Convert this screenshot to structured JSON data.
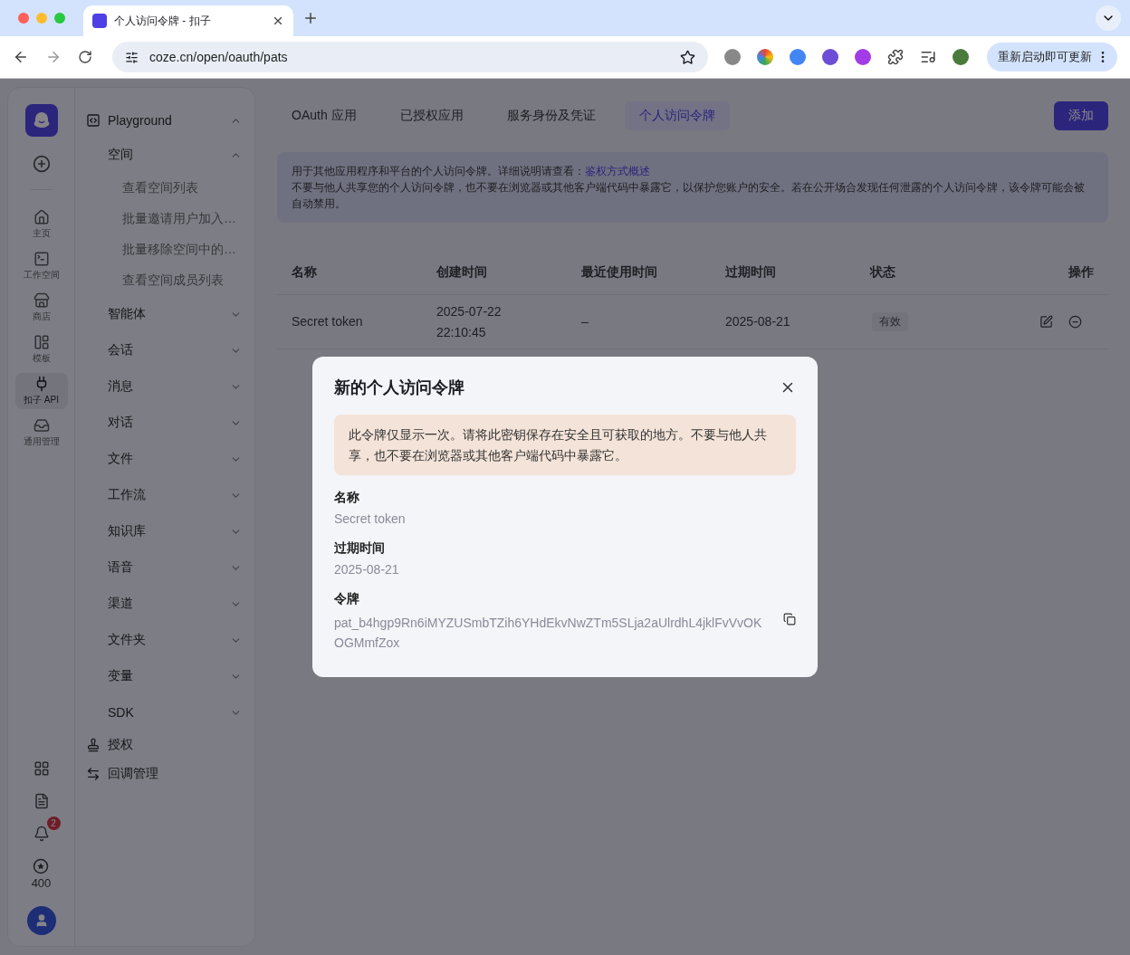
{
  "browser": {
    "tab_title": "个人访问令牌 - 扣子",
    "url": "coze.cn/open/oauth/pats",
    "update_button": "重新启动即可更新"
  },
  "rail": {
    "items": [
      {
        "label": "主页",
        "selected": false
      },
      {
        "label": "工作空间",
        "selected": false
      },
      {
        "label": "商店",
        "selected": false
      },
      {
        "label": "模板",
        "selected": false
      },
      {
        "label": "扣子 API",
        "selected": true
      },
      {
        "label": "通用管理",
        "selected": false
      }
    ],
    "notification_count": "2",
    "points": "400"
  },
  "nav": {
    "items": [
      {
        "label": "Playground",
        "expanded": true,
        "children": [
          {
            "label": "空间",
            "expanded": true,
            "children": [
              {
                "label": "查看空间列表"
              },
              {
                "label": "批量邀请用户加入…"
              },
              {
                "label": "批量移除空间中的…"
              },
              {
                "label": "查看空间成员列表"
              }
            ]
          },
          {
            "label": "智能体",
            "expanded": false
          },
          {
            "label": "会话",
            "expanded": false
          },
          {
            "label": "消息",
            "expanded": false
          },
          {
            "label": "对话",
            "expanded": false
          },
          {
            "label": "文件",
            "expanded": false
          },
          {
            "label": "工作流",
            "expanded": false
          },
          {
            "label": "知识库",
            "expanded": false
          },
          {
            "label": "语音",
            "expanded": false
          },
          {
            "label": "渠道",
            "expanded": false
          },
          {
            "label": "文件夹",
            "expanded": false
          },
          {
            "label": "变量",
            "expanded": false
          },
          {
            "label": "SDK",
            "expanded": false
          }
        ]
      },
      {
        "label": "授权"
      },
      {
        "label": "回调管理"
      }
    ]
  },
  "tabs": [
    {
      "label": "OAuth 应用",
      "selected": false
    },
    {
      "label": "已授权应用",
      "selected": false
    },
    {
      "label": "服务身份及凭证",
      "selected": false
    },
    {
      "label": "个人访问令牌",
      "selected": true
    }
  ],
  "add_button": "添加",
  "notice": {
    "text": "用于其他应用程序和平台的个人访问令牌。详细说明请查看：",
    "link": "鉴权方式概述",
    "warning": "不要与他人共享您的个人访问令牌，也不要在浏览器或其他客户端代码中暴露它，以保护您账户的安全。若在公开场合发现任何泄露的个人访问令牌，该令牌可能会被自动禁用。"
  },
  "table": {
    "columns": [
      "名称",
      "创建时间",
      "最近使用时间",
      "过期时间",
      "状态",
      "操作"
    ],
    "rows": [
      {
        "name": "Secret token",
        "created": "2025-07-22 22:10:45",
        "last_used": "–",
        "expires": "2025-08-21",
        "status": "有效"
      }
    ]
  },
  "dialog": {
    "title": "新的个人访问令牌",
    "alert": "此令牌仅显示一次。请将此密钥保存在安全且可获取的地方。不要与他人共享，也不要在浏览器或其他客户端代码中暴露它。",
    "fields": [
      {
        "kind": "text",
        "label": "名称",
        "value": "Secret token"
      },
      {
        "kind": "text",
        "label": "过期时间",
        "value": "2025-08-21"
      },
      {
        "kind": "token",
        "label": "令牌",
        "value": "pat_b4hgp9Rn6iMYZUSmbTZih6YHdEkvNwZTm5SLja2aUlrdhL4jklFvVvOKOGMmfZox"
      }
    ]
  }
}
